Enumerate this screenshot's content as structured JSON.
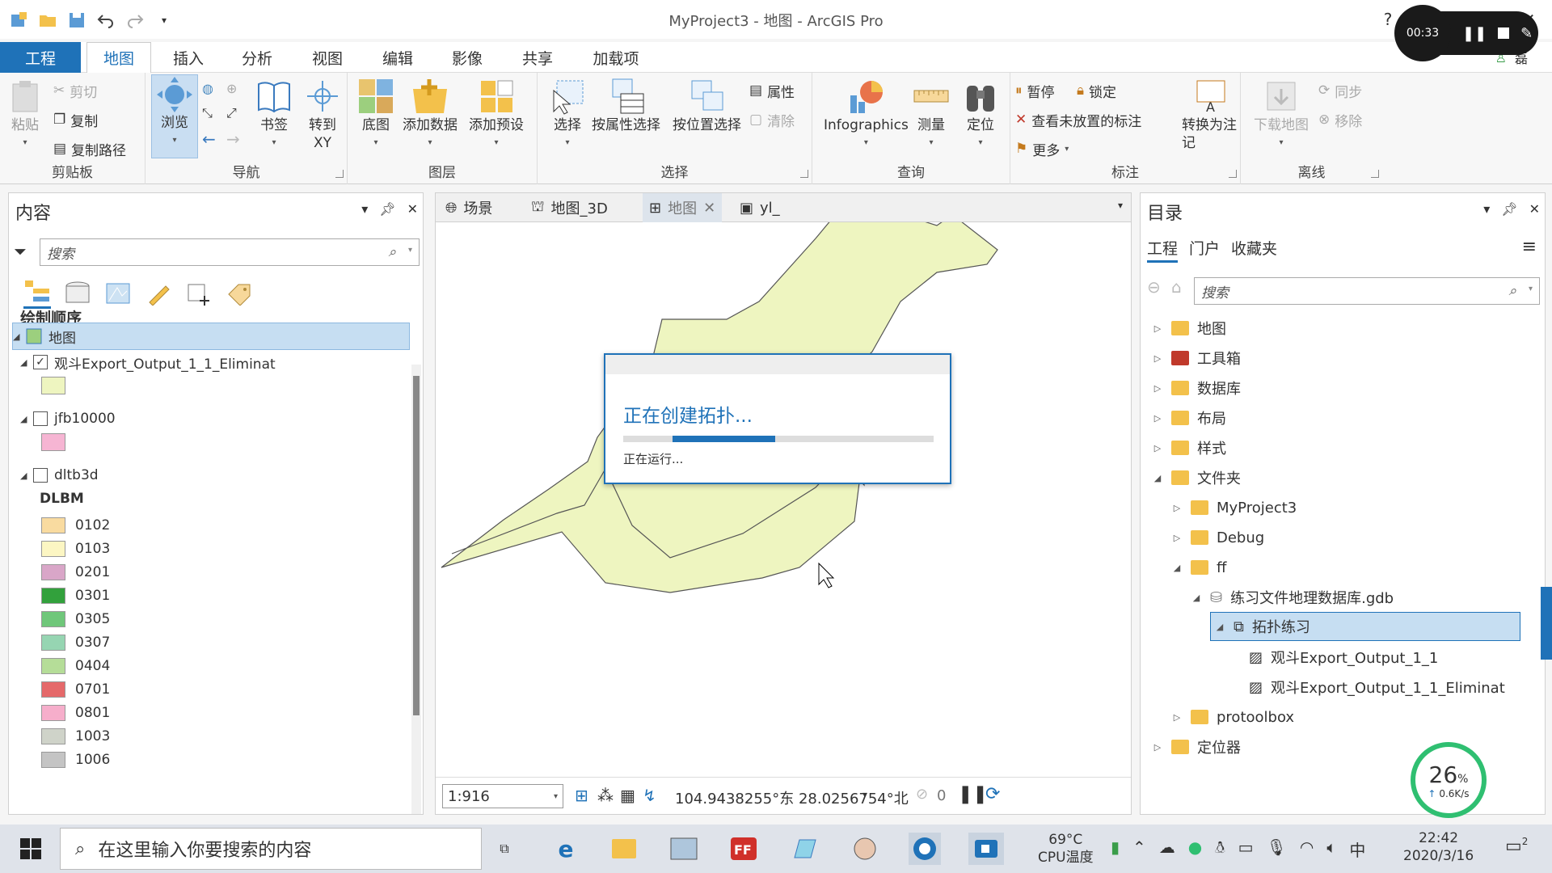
{
  "window": {
    "title": "MyProject3 - 地图 - ArcGIS Pro",
    "help": "?",
    "user_name": "磊"
  },
  "recorder": {
    "time": "00:33"
  },
  "ribbon_tabs": [
    {
      "label": "工程"
    },
    {
      "label": "地图"
    },
    {
      "label": "插入"
    },
    {
      "label": "分析"
    },
    {
      "label": "视图"
    },
    {
      "label": "编辑"
    },
    {
      "label": "影像"
    },
    {
      "label": "共享"
    },
    {
      "label": "加载项"
    }
  ],
  "ribbon": {
    "clipboard": {
      "group": "剪贴板",
      "paste": "粘贴",
      "cut": "剪切",
      "copy": "复制",
      "copy_path": "复制路径"
    },
    "navigate": {
      "group": "导航",
      "explore": "浏览",
      "bookmarks": "书签",
      "goto_xy": "转到\nXY"
    },
    "layer": {
      "group": "图层",
      "basemap": "底图",
      "add_data": "添加数据",
      "add_preset": "添加预设"
    },
    "selection": {
      "group": "选择",
      "select": "选择",
      "select_by_attr": "按属性选择",
      "select_by_loc": "按位置选择",
      "attributes": "属性",
      "clear": "清除"
    },
    "inquiry": {
      "group": "查询",
      "infographics": "Infographics",
      "measure": "测量",
      "locate": "定位"
    },
    "labeling": {
      "group": "标注",
      "pause": "暂停",
      "lock": "锁定",
      "unplaced": "查看未放置的标注",
      "more": "更多",
      "convert": "转换为注记"
    },
    "offline": {
      "group": "离线",
      "download": "下载地图",
      "sync": "同步",
      "remove": "移除"
    }
  },
  "contents": {
    "title": "内容",
    "search_placeholder": "搜索",
    "section": "绘制顺序",
    "map_name": "地图",
    "layers": [
      {
        "name": "观斗Export_Output_1_1_Eliminat",
        "checked": "✓",
        "color": "#eef5c0"
      },
      {
        "name": "jfb10000",
        "checked": "",
        "color": "#f6b5d3"
      },
      {
        "name": "dltb3d",
        "checked": ""
      }
    ],
    "legend_field": "DLBM",
    "legend": [
      {
        "code": "0102",
        "color": "#f9dba0"
      },
      {
        "code": "0103",
        "color": "#fcf6c3"
      },
      {
        "code": "0201",
        "color": "#d9a6c8"
      },
      {
        "code": "0301",
        "color": "#32a13c"
      },
      {
        "code": "0305",
        "color": "#6fc77a"
      },
      {
        "code": "0307",
        "color": "#96d5b2"
      },
      {
        "code": "0404",
        "color": "#b5dd98"
      },
      {
        "code": "0701",
        "color": "#e5696a"
      },
      {
        "code": "0801",
        "color": "#f6aecb"
      },
      {
        "code": "1003",
        "color": "#cfd3c9"
      },
      {
        "code": "1006",
        "color": "#c4c4c4"
      }
    ]
  },
  "map_tabs": [
    {
      "label": "场景"
    },
    {
      "label": "地图_3D"
    },
    {
      "label": "地图"
    },
    {
      "label": "yl_"
    }
  ],
  "map_status": {
    "scale": "1:916",
    "coords": "104.9438255°东 28.0256754°北",
    "selected": "0"
  },
  "dialog": {
    "message": "正在创建拓扑...",
    "status": "正在运行...",
    "progress_start": 0.16,
    "progress_end": 0.49
  },
  "catalog": {
    "title": "目录",
    "tabs": [
      "工程",
      "门户",
      "收藏夹"
    ],
    "search_placeholder": "搜索",
    "items": [
      {
        "label": "地图"
      },
      {
        "label": "工具箱"
      },
      {
        "label": "数据库"
      },
      {
        "label": "布局"
      },
      {
        "label": "样式"
      },
      {
        "label": "文件夹"
      },
      {
        "label": "MyProject3"
      },
      {
        "label": "Debug"
      },
      {
        "label": "ff"
      },
      {
        "label": "练习文件地理数据库.gdb"
      },
      {
        "label": "拓扑练习"
      },
      {
        "label": "观斗Export_Output_1_1"
      },
      {
        "label": "观斗Export_Output_1_1_Eliminat"
      },
      {
        "label": "protoolbox"
      },
      {
        "label": "定位器"
      }
    ]
  },
  "perf": {
    "percent": "26",
    "unit": "%",
    "rate": "0.6K/s"
  },
  "taskbar": {
    "search": "在这里输入你要搜索的内容",
    "temp": "69°C",
    "temp_label": "CPU温度",
    "ime": "中",
    "time": "22:42",
    "date": "2020/3/16",
    "notif": "2"
  }
}
